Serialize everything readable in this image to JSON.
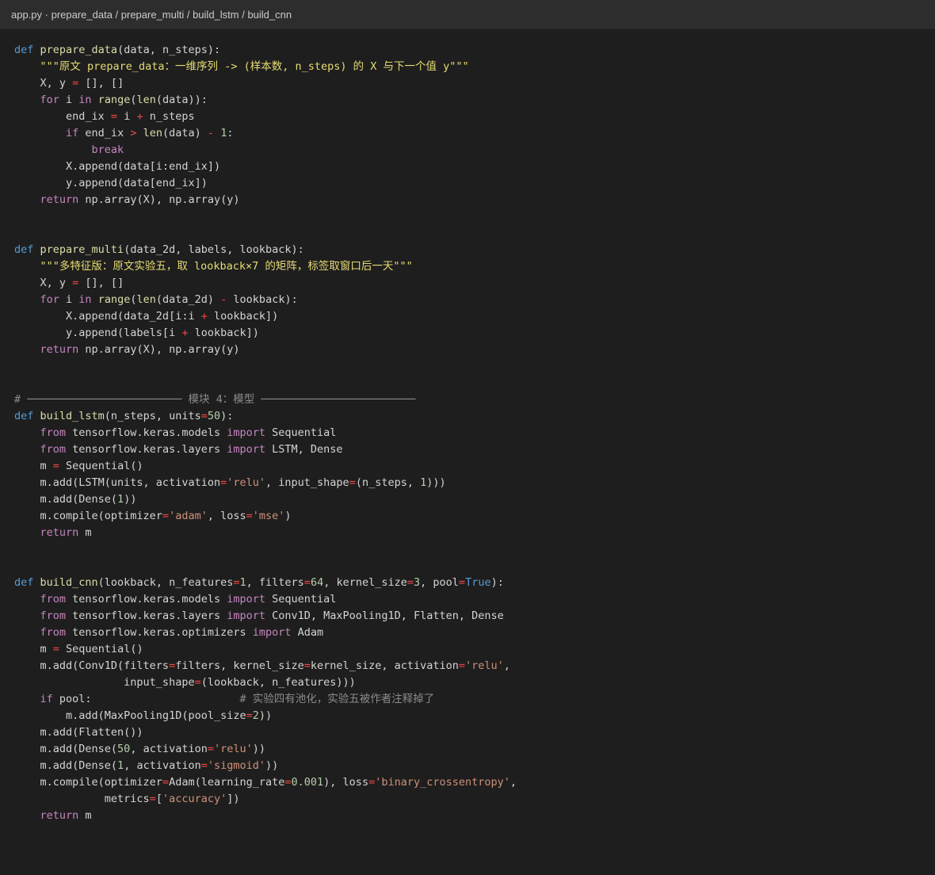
{
  "window": {
    "breadcrumb": "app.py · prepare_data / prepare_multi / build_lstm / build_cnn"
  },
  "colors": {
    "background": "#1e1e1e",
    "titlebar": "#2d2d2d",
    "keyword": "#569cd6",
    "control": "#c586c0",
    "function": "#dcdcaa",
    "string": "#ce9178",
    "docstring": "#e6db74",
    "number": "#b5cea8",
    "operator": "#f44747",
    "comment": "#8b8b8b",
    "text": "#d4d4d4"
  },
  "code": {
    "lines": [
      [
        [
          "kw",
          "def "
        ],
        [
          "fn",
          "prepare_data"
        ],
        [
          "t",
          "(data, n_steps):"
        ]
      ],
      [
        [
          "t",
          "    "
        ],
        [
          "doc",
          "\"\"\"原文 prepare_data：一维序列 -> (样本数, n_steps) 的 X 与下一个值 y\"\"\""
        ]
      ],
      [
        [
          "t",
          "    X, y "
        ],
        [
          "op",
          "="
        ],
        [
          "t",
          " [], []"
        ]
      ],
      [
        [
          "t",
          "    "
        ],
        [
          "ctl",
          "for"
        ],
        [
          "t",
          " i "
        ],
        [
          "ctl",
          "in"
        ],
        [
          "t",
          " "
        ],
        [
          "fn",
          "range"
        ],
        [
          "t",
          "("
        ],
        [
          "fn",
          "len"
        ],
        [
          "t",
          "(data)):"
        ]
      ],
      [
        [
          "t",
          "        end_ix "
        ],
        [
          "op",
          "="
        ],
        [
          "t",
          " i "
        ],
        [
          "op",
          "+"
        ],
        [
          "t",
          " n_steps"
        ]
      ],
      [
        [
          "t",
          "        "
        ],
        [
          "ctl",
          "if"
        ],
        [
          "t",
          " end_ix "
        ],
        [
          "op",
          ">"
        ],
        [
          "t",
          " "
        ],
        [
          "fn",
          "len"
        ],
        [
          "t",
          "(data) "
        ],
        [
          "op",
          "-"
        ],
        [
          "t",
          " "
        ],
        [
          "num",
          "1"
        ],
        [
          "t",
          ":"
        ]
      ],
      [
        [
          "t",
          "            "
        ],
        [
          "ctl",
          "break"
        ]
      ],
      [
        [
          "t",
          "        X.append(data[i:end_ix])"
        ]
      ],
      [
        [
          "t",
          "        y.append(data[end_ix])"
        ]
      ],
      [
        [
          "t",
          "    "
        ],
        [
          "ctl",
          "return"
        ],
        [
          "t",
          " np.array(X), np.array(y)"
        ]
      ],
      [],
      [],
      [
        [
          "kw",
          "def "
        ],
        [
          "fn",
          "prepare_multi"
        ],
        [
          "t",
          "(data_2d, labels, lookback):"
        ]
      ],
      [
        [
          "t",
          "    "
        ],
        [
          "doc",
          "\"\"\"多特征版：原文实验五，取 lookback×7 的矩阵，标签取窗口后一天\"\"\""
        ]
      ],
      [
        [
          "t",
          "    X, y "
        ],
        [
          "op",
          "="
        ],
        [
          "t",
          " [], []"
        ]
      ],
      [
        [
          "t",
          "    "
        ],
        [
          "ctl",
          "for"
        ],
        [
          "t",
          " i "
        ],
        [
          "ctl",
          "in"
        ],
        [
          "t",
          " "
        ],
        [
          "fn",
          "range"
        ],
        [
          "t",
          "("
        ],
        [
          "fn",
          "len"
        ],
        [
          "t",
          "(data_2d) "
        ],
        [
          "op",
          "-"
        ],
        [
          "t",
          " lookback):"
        ]
      ],
      [
        [
          "t",
          "        X.append(data_2d[i:i "
        ],
        [
          "op",
          "+"
        ],
        [
          "t",
          " lookback])"
        ]
      ],
      [
        [
          "t",
          "        y.append(labels[i "
        ],
        [
          "op",
          "+"
        ],
        [
          "t",
          " lookback])"
        ]
      ],
      [
        [
          "t",
          "    "
        ],
        [
          "ctl",
          "return"
        ],
        [
          "t",
          " np.array(X), np.array(y)"
        ]
      ],
      [],
      [],
      [
        [
          "cmt",
          "# ──────────────────────── 模块 4：模型 ────────────────────────"
        ]
      ],
      [
        [
          "kw",
          "def "
        ],
        [
          "fn",
          "build_lstm"
        ],
        [
          "t",
          "(n_steps, units"
        ],
        [
          "op",
          "="
        ],
        [
          "num",
          "50"
        ],
        [
          "t",
          "):"
        ]
      ],
      [
        [
          "t",
          "    "
        ],
        [
          "ctl",
          "from"
        ],
        [
          "t",
          " tensorflow.keras.models "
        ],
        [
          "ctl",
          "import"
        ],
        [
          "t",
          " Sequential"
        ]
      ],
      [
        [
          "t",
          "    "
        ],
        [
          "ctl",
          "from"
        ],
        [
          "t",
          " tensorflow.keras.layers "
        ],
        [
          "ctl",
          "import"
        ],
        [
          "t",
          " LSTM, Dense"
        ]
      ],
      [
        [
          "t",
          "    m "
        ],
        [
          "op",
          "="
        ],
        [
          "t",
          " Sequential()"
        ]
      ],
      [
        [
          "t",
          "    m.add(LSTM(units, activation"
        ],
        [
          "op",
          "="
        ],
        [
          "str",
          "'relu'"
        ],
        [
          "t",
          ", input_shape"
        ],
        [
          "op",
          "="
        ],
        [
          "t",
          "(n_steps, "
        ],
        [
          "num",
          "1"
        ],
        [
          "t",
          ")))"
        ]
      ],
      [
        [
          "t",
          "    m.add(Dense("
        ],
        [
          "num",
          "1"
        ],
        [
          "t",
          "))"
        ]
      ],
      [
        [
          "t",
          "    m.compile(optimizer"
        ],
        [
          "op",
          "="
        ],
        [
          "str",
          "'adam'"
        ],
        [
          "t",
          ", loss"
        ],
        [
          "op",
          "="
        ],
        [
          "str",
          "'mse'"
        ],
        [
          "t",
          ")"
        ]
      ],
      [
        [
          "t",
          "    "
        ],
        [
          "ctl",
          "return"
        ],
        [
          "t",
          " m"
        ]
      ],
      [],
      [],
      [
        [
          "kw",
          "def "
        ],
        [
          "fn",
          "build_cnn"
        ],
        [
          "t",
          "(lookback, n_features"
        ],
        [
          "op",
          "="
        ],
        [
          "num",
          "1"
        ],
        [
          "t",
          ", filters"
        ],
        [
          "op",
          "="
        ],
        [
          "num",
          "64"
        ],
        [
          "t",
          ", kernel_size"
        ],
        [
          "op",
          "="
        ],
        [
          "num",
          "3"
        ],
        [
          "t",
          ", pool"
        ],
        [
          "op",
          "="
        ],
        [
          "kw",
          "True"
        ],
        [
          "t",
          "):"
        ]
      ],
      [
        [
          "t",
          "    "
        ],
        [
          "ctl",
          "from"
        ],
        [
          "t",
          " tensorflow.keras.models "
        ],
        [
          "ctl",
          "import"
        ],
        [
          "t",
          " Sequential"
        ]
      ],
      [
        [
          "t",
          "    "
        ],
        [
          "ctl",
          "from"
        ],
        [
          "t",
          " tensorflow.keras.layers "
        ],
        [
          "ctl",
          "import"
        ],
        [
          "t",
          " Conv1D, MaxPooling1D, Flatten, Dense"
        ]
      ],
      [
        [
          "t",
          "    "
        ],
        [
          "ctl",
          "from"
        ],
        [
          "t",
          " tensorflow.keras.optimizers "
        ],
        [
          "ctl",
          "import"
        ],
        [
          "t",
          " Adam"
        ]
      ],
      [
        [
          "t",
          "    m "
        ],
        [
          "op",
          "="
        ],
        [
          "t",
          " Sequential()"
        ]
      ],
      [
        [
          "t",
          "    m.add(Conv1D(filters"
        ],
        [
          "op",
          "="
        ],
        [
          "t",
          "filters, kernel_size"
        ],
        [
          "op",
          "="
        ],
        [
          "t",
          "kernel_size, activation"
        ],
        [
          "op",
          "="
        ],
        [
          "str",
          "'relu'"
        ],
        [
          "t",
          ","
        ]
      ],
      [
        [
          "t",
          "                 input_shape"
        ],
        [
          "op",
          "="
        ],
        [
          "t",
          "(lookback, n_features)))"
        ]
      ],
      [
        [
          "t",
          "    "
        ],
        [
          "ctl",
          "if"
        ],
        [
          "t",
          " pool:                       "
        ],
        [
          "cmt",
          "# 实验四有池化，实验五被作者注释掉了"
        ]
      ],
      [
        [
          "t",
          "        m.add(MaxPooling1D(pool_size"
        ],
        [
          "op",
          "="
        ],
        [
          "num",
          "2"
        ],
        [
          "t",
          "))"
        ]
      ],
      [
        [
          "t",
          "    m.add(Flatten())"
        ]
      ],
      [
        [
          "t",
          "    m.add(Dense("
        ],
        [
          "num",
          "50"
        ],
        [
          "t",
          ", activation"
        ],
        [
          "op",
          "="
        ],
        [
          "str",
          "'relu'"
        ],
        [
          "t",
          "))"
        ]
      ],
      [
        [
          "t",
          "    m.add(Dense("
        ],
        [
          "num",
          "1"
        ],
        [
          "t",
          ", activation"
        ],
        [
          "op",
          "="
        ],
        [
          "str",
          "'sigmoid'"
        ],
        [
          "t",
          "))"
        ]
      ],
      [
        [
          "t",
          "    m.compile(optimizer"
        ],
        [
          "op",
          "="
        ],
        [
          "t",
          "Adam(learning_rate"
        ],
        [
          "op",
          "="
        ],
        [
          "num",
          "0.001"
        ],
        [
          "t",
          "), loss"
        ],
        [
          "op",
          "="
        ],
        [
          "str",
          "'binary_crossentropy'"
        ],
        [
          "t",
          ","
        ]
      ],
      [
        [
          "t",
          "              metrics"
        ],
        [
          "op",
          "="
        ],
        [
          "t",
          "["
        ],
        [
          "str",
          "'accuracy'"
        ],
        [
          "t",
          "])"
        ]
      ],
      [
        [
          "t",
          "    "
        ],
        [
          "ctl",
          "return"
        ],
        [
          "t",
          " m"
        ]
      ]
    ]
  }
}
